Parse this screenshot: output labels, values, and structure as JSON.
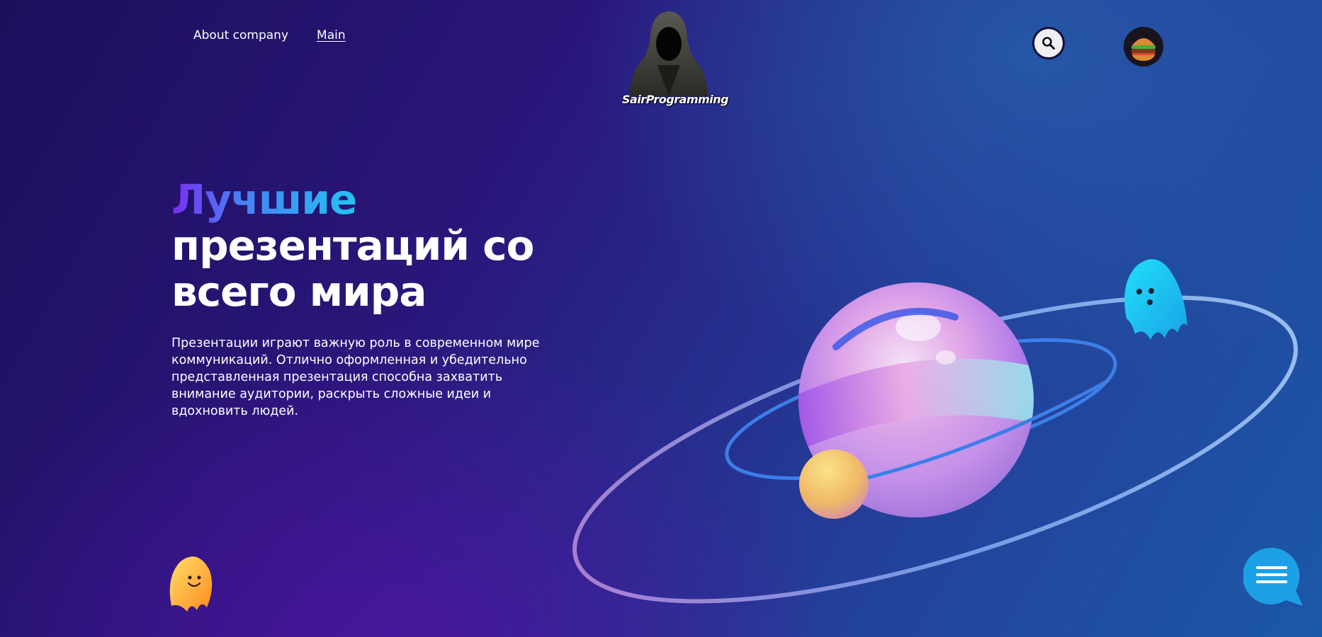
{
  "nav": {
    "about_label": "About company",
    "main_label": "Main"
  },
  "logo": {
    "text": "SairProgramming"
  },
  "header": {
    "search_icon": "search-icon",
    "avatar": "burger-avatar"
  },
  "hero": {
    "title_accent": "Лучшие",
    "title_line2": "презентаций со",
    "title_line3": "всего мира",
    "description": "Презентации играют важную роль в современном мире коммуникаций. Отлично оформленная и убедительно представленная презентация способна захватить внимание аудитории, раскрыть сложные идеи и вдохновить людей."
  },
  "widgets": {
    "chat_icon": "chat-menu-icon"
  },
  "colors": {
    "accent_gradient_start": "#7a2df0",
    "accent_gradient_end": "#22c4f2",
    "chat_button": "#1ea0e6"
  }
}
